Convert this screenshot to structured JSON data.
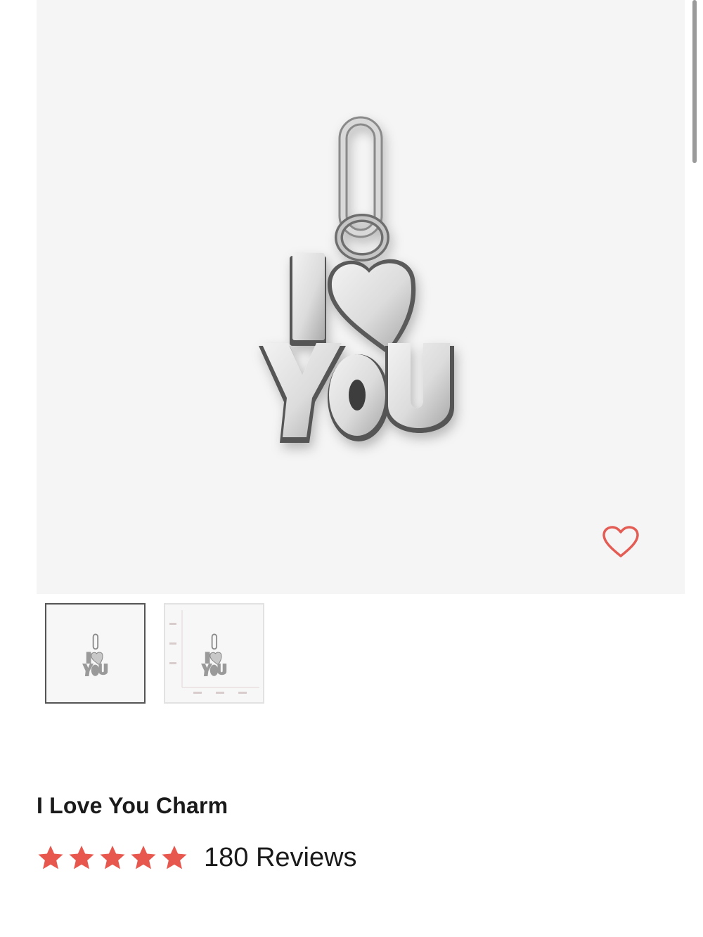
{
  "product": {
    "title": "I Love You Charm",
    "image_icon": "i-love-you-charm-image",
    "charm_letters": {
      "top_left": "I",
      "bottom": "YOU"
    }
  },
  "rating": {
    "stars": 5,
    "reviews_label": "180 Reviews",
    "star_color": "#e8574d"
  },
  "favorite": {
    "icon": "heart-outline-icon",
    "color": "#e35d55"
  },
  "thumbnails": [
    {
      "name": "thumbnail-product-front",
      "selected": true
    },
    {
      "name": "thumbnail-product-dimensions",
      "selected": false
    }
  ]
}
